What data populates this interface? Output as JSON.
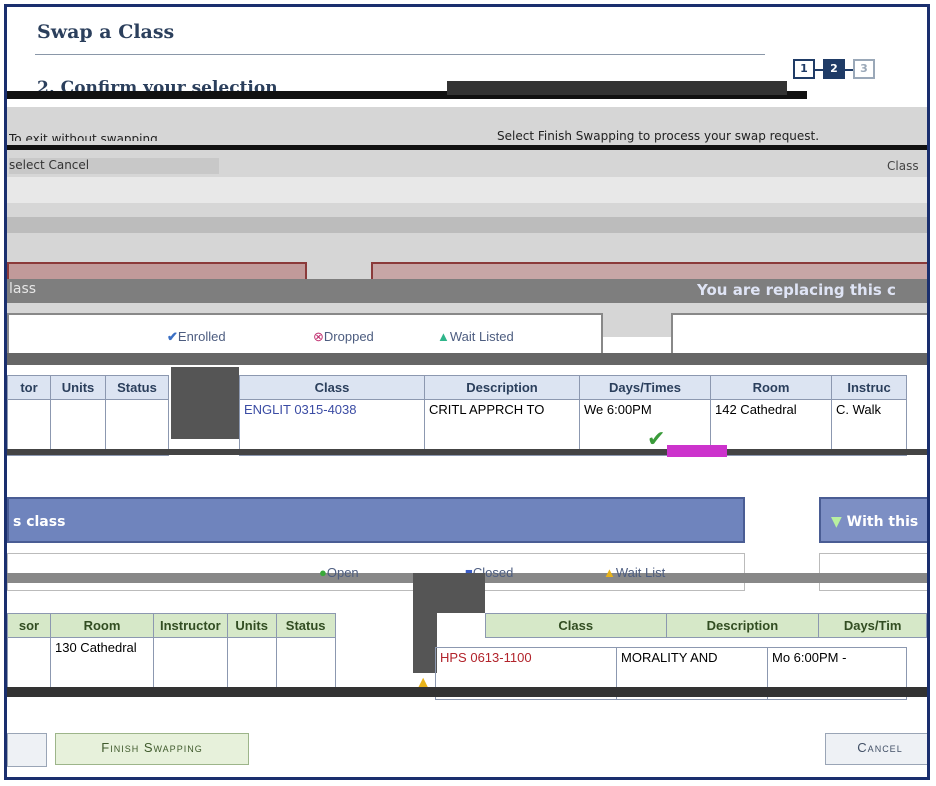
{
  "page": {
    "title": "Swap a Class",
    "section_heading": "2. Confirm your selection",
    "instructions_right": "Select Finish Swapping to process your swap request.",
    "instructions_left": "To exit without swapping,",
    "cancel_hint": "select Cancel",
    "term_label": "Class"
  },
  "steps": [
    "1",
    "2",
    "3"
  ],
  "replacing_panel": {
    "left_label": "lass",
    "right_label": "You are replacing this c"
  },
  "legend_top": {
    "enrolled": "Enrolled",
    "dropped": "Dropped",
    "wait_listed": "Wait Listed"
  },
  "top_table": {
    "left_headers": [
      "tor",
      "Units",
      "Status"
    ],
    "right_headers": [
      "Class",
      "Description",
      "Days/Times",
      "Room",
      "Instruc"
    ],
    "row": {
      "class": "ENGLIT 0315-4038",
      "description": "CRITL APPRCH TO",
      "days": "We 6:00PM",
      "room": "142 Cathedral",
      "instructor": "C. Walk"
    }
  },
  "with_panel": {
    "left_label": "s class",
    "right_label": "With this"
  },
  "legend_bottom": {
    "open": "Open",
    "closed": "Closed",
    "wait_list": "Wait List"
  },
  "bottom_table": {
    "left_headers": [
      "sor",
      "Room",
      "Instructor",
      "Units",
      "Status"
    ],
    "right_headers": [
      "Class",
      "Description",
      "Days/Tim"
    ],
    "row": {
      "room": "130 Cathedral",
      "class": "HPS 0613-1100",
      "description": "MORALITY AND",
      "days": "Mo 6:00PM -"
    }
  },
  "buttons": {
    "finish": "Finish Swapping",
    "cancel": "Cancel"
  }
}
